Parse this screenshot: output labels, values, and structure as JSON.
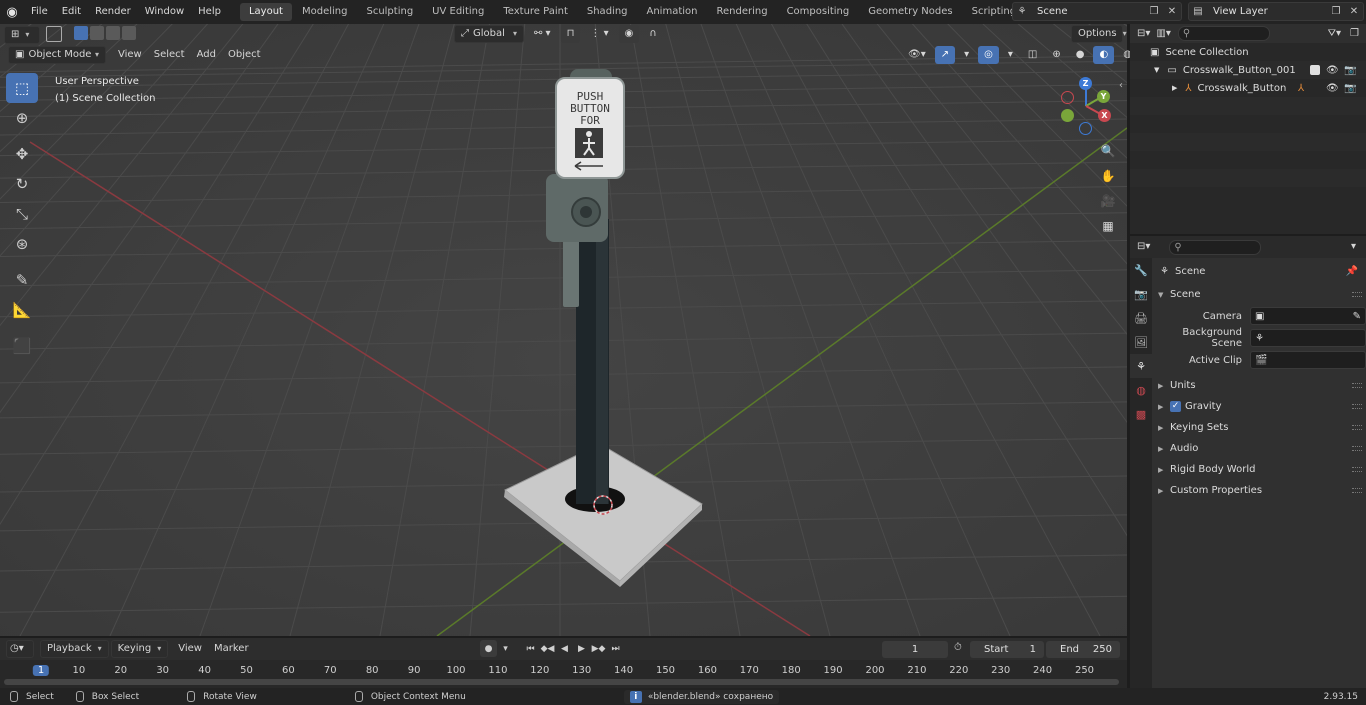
{
  "topbar": {
    "menus": [
      "File",
      "Edit",
      "Render",
      "Window",
      "Help"
    ],
    "workspaces": [
      "Layout",
      "Modeling",
      "Sculpting",
      "UV Editing",
      "Texture Paint",
      "Shading",
      "Animation",
      "Rendering",
      "Compositing",
      "Geometry Nodes",
      "Scripting"
    ],
    "active_workspace": "Layout",
    "scene_name": "Scene",
    "view_layer_name": "View Layer"
  },
  "viewport": {
    "mode": "Object Mode",
    "menus": [
      "View",
      "Select",
      "Add",
      "Object"
    ],
    "transform_orientation": "Global",
    "options_label": "Options",
    "overlay_line1": "User Perspective",
    "overlay_line2": "(1) Scene Collection",
    "gizmo": {
      "z": "Z",
      "y": "Y",
      "x": "X"
    },
    "colors": {
      "x_axis": "#c84850",
      "y_axis": "#7aa63a",
      "z_axis": "#3d7ad6",
      "active": "#4772b3"
    }
  },
  "model": {
    "sign_text_line1": "PUSH",
    "sign_text_line2": "BUTTON",
    "sign_text_line3": "FOR"
  },
  "outliner": {
    "root": "Scene Collection",
    "collection": "Crosswalk_Button_001",
    "object": "Crosswalk_Button"
  },
  "properties": {
    "context_title": "Scene",
    "panel_title": "Scene",
    "camera_label": "Camera",
    "background_scene_label": "Background Scene",
    "active_clip_label": "Active Clip",
    "panels": [
      "Units",
      "Gravity",
      "Keying Sets",
      "Audio",
      "Rigid Body World",
      "Custom Properties"
    ],
    "gravity_checked": true
  },
  "timeline": {
    "menus": [
      "Playback",
      "Keying",
      "View",
      "Marker"
    ],
    "current_frame": "1",
    "start_label": "Start",
    "start_value": "1",
    "end_label": "End",
    "end_value": "250",
    "ruler_ticks": [
      "1",
      "10",
      "20",
      "30",
      "40",
      "50",
      "60",
      "70",
      "80",
      "90",
      "100",
      "110",
      "120",
      "130",
      "140",
      "150",
      "160",
      "170",
      "180",
      "190",
      "200",
      "210",
      "220",
      "230",
      "240",
      "250"
    ]
  },
  "statusbar": {
    "select": "Select",
    "box_select": "Box Select",
    "rotate_view": "Rotate View",
    "context_menu": "Object Context Menu",
    "message": "«blender.blend» сохранено",
    "version": "2.93.15"
  }
}
